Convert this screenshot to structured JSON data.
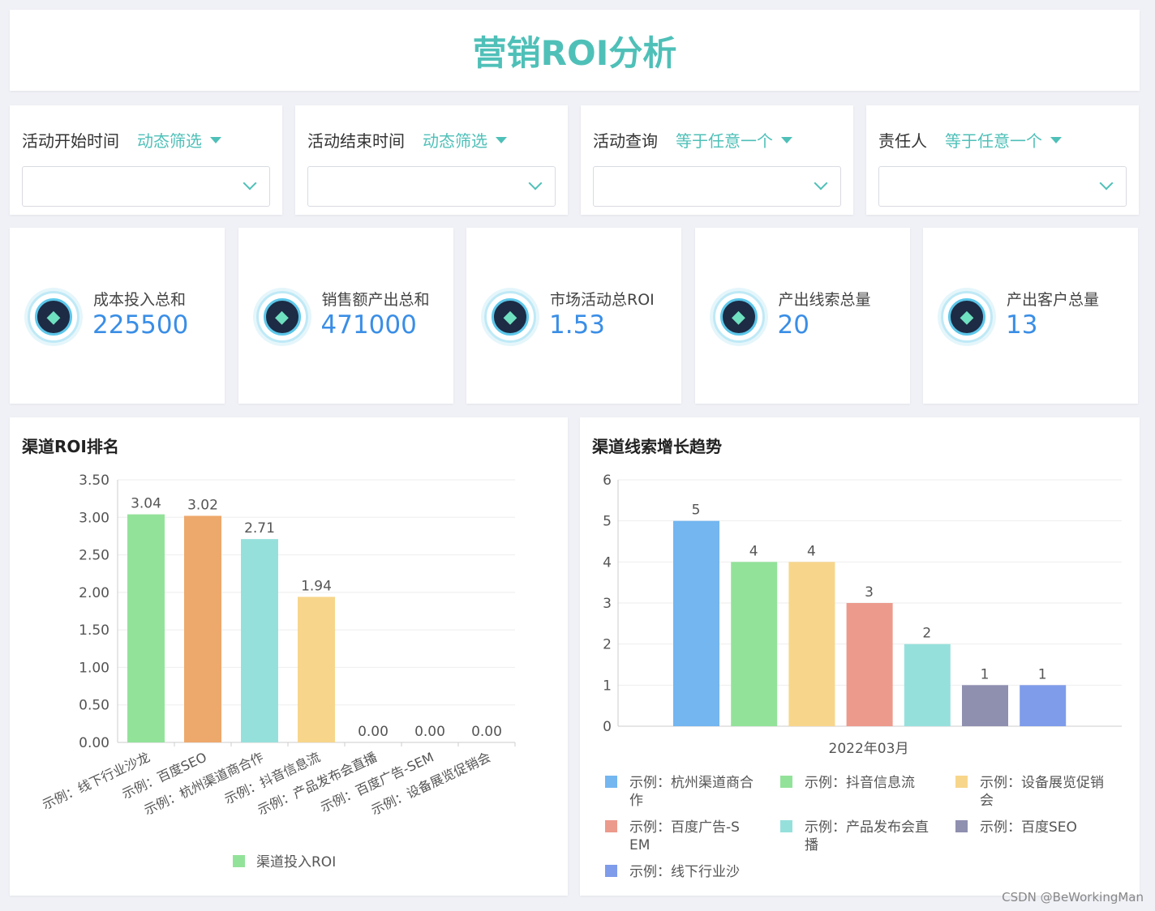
{
  "header": {
    "title": "营销ROI分析"
  },
  "filters": [
    {
      "label": "活动开始时间",
      "mode": "动态筛选"
    },
    {
      "label": "活动结束时间",
      "mode": "动态筛选"
    },
    {
      "label": "活动查询",
      "mode": "等于任意一个"
    },
    {
      "label": "责任人",
      "mode": "等于任意一个"
    }
  ],
  "kpis": [
    {
      "label": "成本投入总和",
      "value": "225500",
      "icon": "diamond-icon"
    },
    {
      "label": "销售额产出总和",
      "value": "471000",
      "icon": "diamond-icon"
    },
    {
      "label": "市场活动总ROI",
      "value": "1.53",
      "icon": "diamond-icon"
    },
    {
      "label": "产出线索总量",
      "value": "20",
      "icon": "diamond-icon"
    },
    {
      "label": "产出客户总量",
      "value": "13",
      "icon": "diamond-icon"
    }
  ],
  "chart_data": [
    {
      "type": "bar",
      "title": "渠道ROI排名",
      "ylim": [
        0,
        3.5
      ],
      "yticks": [
        "0.00",
        "0.50",
        "1.00",
        "1.50",
        "2.00",
        "2.50",
        "3.00",
        "3.50"
      ],
      "categories": [
        "示例：线下行业沙龙",
        "示例：百度SEO",
        "示例：杭州渠道商合作",
        "示例：抖音信息流",
        "示例：产品发布会直播",
        "示例：百度广告-SEM",
        "示例：设备展览促销会"
      ],
      "values": [
        3.04,
        3.02,
        2.71,
        1.94,
        0,
        0,
        0
      ],
      "labels": [
        "3.04",
        "3.02",
        "2.71",
        "1.94",
        "0.00",
        "0.00",
        "0.00"
      ],
      "colors": [
        "#93e29a",
        "#eda86b",
        "#96e0dc",
        "#f7d68b",
        "#93e29a",
        "#93e29a",
        "#93e29a"
      ],
      "legend": {
        "name": "渠道投入ROI",
        "color": "#93e29a",
        "placement": "bottom"
      }
    },
    {
      "type": "bar",
      "title": "渠道线索增长趋势",
      "ylim": [
        0,
        6
      ],
      "yticks": [
        "0",
        "1",
        "2",
        "3",
        "4",
        "5",
        "6"
      ],
      "xlabel": "2022年03月",
      "series": [
        {
          "name": "示例：杭州渠道商合作",
          "value": 5,
          "color": "#73b6f0"
        },
        {
          "name": "示例：抖音信息流",
          "value": 4,
          "color": "#93e29a"
        },
        {
          "name": "示例：设备展览促销会",
          "value": 4,
          "color": "#f7d68b"
        },
        {
          "name": "示例：百度广告-SEM",
          "value": 3,
          "color": "#ec9a8c"
        },
        {
          "name": "示例：产品发布会直播",
          "value": 2,
          "color": "#96e0dc"
        },
        {
          "name": "示例：百度SEO",
          "value": 1,
          "color": "#8f8fb0"
        },
        {
          "name": "示例：线下行业沙",
          "value": 1,
          "color": "#7f9cea"
        }
      ],
      "legend_placement": "bottom"
    }
  ],
  "watermark": "CSDN @BeWorkingMan"
}
